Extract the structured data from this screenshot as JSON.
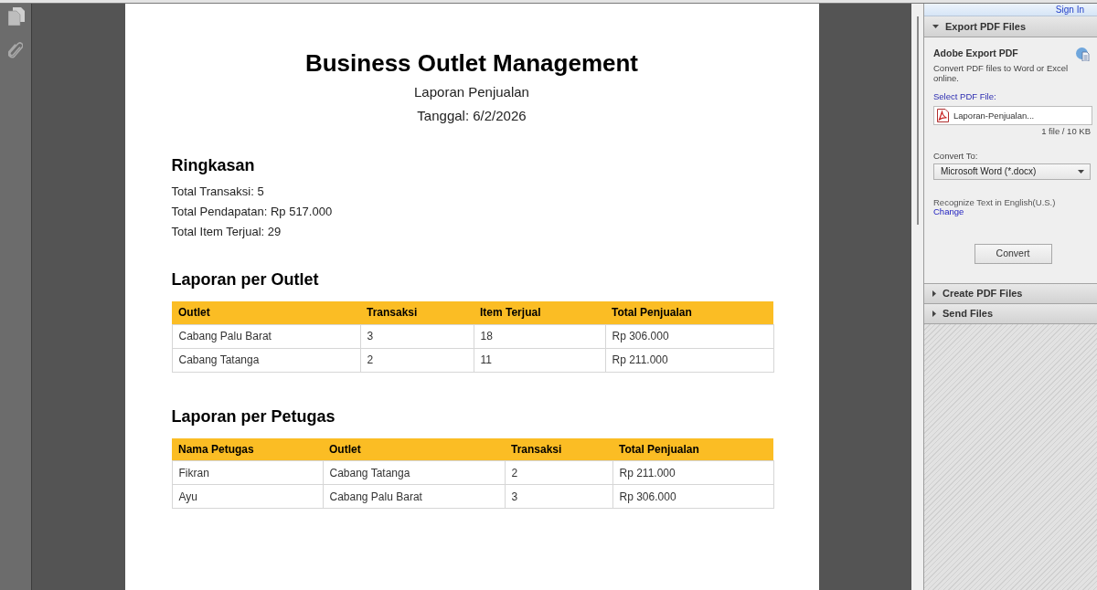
{
  "document": {
    "title": "Business Outlet Management",
    "subtitle": "Laporan Penjualan",
    "date": "Tanggal: 6/2/2026",
    "sections": [
      {
        "kind": "summary",
        "heading": "Ringkasan",
        "lines": [
          "Total Transaksi: 5",
          "Total Pendapatan: Rp 517.000",
          "Total Item Terjual: 29"
        ]
      },
      {
        "kind": "table",
        "heading": "Laporan per Outlet",
        "columns": [
          "Outlet",
          "Transaksi",
          "Item Terjual",
          "Total Penjualan"
        ],
        "rows": [
          [
            "Cabang Palu Barat",
            "3",
            "18",
            "Rp 306.000"
          ],
          [
            "Cabang Tatanga",
            "2",
            "11",
            "Rp 211.000"
          ]
        ]
      },
      {
        "kind": "table",
        "heading": "Laporan per Petugas",
        "columns": [
          "Nama Petugas",
          "Outlet",
          "Transaksi",
          "Total Penjualan"
        ],
        "rows": [
          [
            "Fikran",
            "Cabang Tatanga",
            "2",
            "Rp 211.000"
          ],
          [
            "Ayu",
            "Cabang Palu Barat",
            "3",
            "Rp 306.000"
          ]
        ]
      }
    ]
  },
  "panel": {
    "sign_in": "Sign In",
    "sections": [
      {
        "title": "Export PDF Files",
        "expanded": true,
        "content": {
          "heading": "Adobe Export PDF",
          "description": "Convert PDF files to Word or Excel online.",
          "select_label": "Select PDF File:",
          "file_name": "Laporan-Penjualan...",
          "file_info": "1 file / 10 KB",
          "convert_label": "Convert To:",
          "format": "Microsoft Word (*.docx)",
          "recognize": "Recognize Text in English(U.S.)",
          "change_link": "Change",
          "button": "Convert"
        }
      },
      {
        "title": "Create PDF Files",
        "expanded": false
      },
      {
        "title": "Send Files",
        "expanded": false
      }
    ]
  }
}
